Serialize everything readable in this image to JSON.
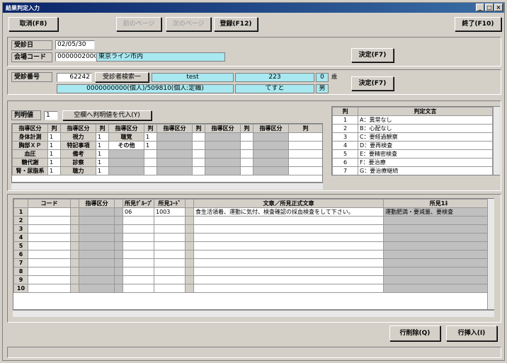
{
  "window": {
    "title": "結果判定入力"
  },
  "toolbar": {
    "cancel": "取消(F8)",
    "disabled1": "前のページ",
    "disabled2": "次のページ",
    "register": "登録(F12)",
    "exit": "終了(F10)"
  },
  "header": {
    "date_label": "受診日",
    "date_value": "02/05/30",
    "org_label": "会場コード",
    "org_code": "0000002000",
    "org_name": "東京ライン市内",
    "decide1": "決定(F7)",
    "exam_label": "受診番号",
    "exam_no": "62242",
    "exam_btn": "受診者検索一",
    "c1": "test",
    "c2": "223",
    "c3": "0",
    "c3_suffix": "歳",
    "c4": "0000000000(個人)/509810(個人:定職)",
    "c5": "てすと",
    "c6": "男",
    "decide2": "決定(F7)"
  },
  "judge": {
    "label": "判明値",
    "value": "1",
    "apply_btn": "空欄へ判明値を代入(Y)",
    "headers": [
      "指導区分",
      "判",
      "指導区分",
      "判",
      "指導区分",
      "判",
      "指導区分",
      "判",
      "指導区分",
      "判",
      "指導区分",
      "判"
    ],
    "rows": [
      [
        "身体計測",
        "1",
        "視力",
        "1",
        "聴覚",
        "1"
      ],
      [
        "胸部ＸＰ",
        "1",
        "特記事項",
        "1",
        "その他",
        "1"
      ],
      [
        "血圧",
        "1",
        "備考",
        "1",
        "",
        ""
      ],
      [
        "糖代謝",
        "1",
        "診察",
        "1",
        "",
        ""
      ],
      [
        "腎・尿脂系",
        "1",
        "聴力",
        "1",
        "",
        ""
      ]
    ]
  },
  "criteria": {
    "headers": [
      "判",
      "判定文言"
    ],
    "rows": [
      [
        "1",
        "A：異常なし"
      ],
      [
        "2",
        "B：心配なし"
      ],
      [
        "3",
        "C：要経過観察"
      ],
      [
        "4",
        "D：要再検査"
      ],
      [
        "5",
        "E：要精密検査"
      ],
      [
        "6",
        "F：要治療"
      ],
      [
        "7",
        "G：要治療継続"
      ]
    ]
  },
  "main": {
    "headers": [
      "コード",
      "指導区分",
      "所見ｸﾞﾙｰﾌﾟ",
      "所見ｺｰﾄﾞ",
      "文章／所見正式文章",
      "所見1ﾈ"
    ],
    "rows": [
      [
        "1",
        "",
        "",
        "06",
        "1003",
        "食生活領着、運動に気付、検査確認の採血検査をして下さい。",
        "運動肥満・要減量、要検査"
      ],
      [
        "2",
        "",
        "",
        "",
        "",
        "",
        ""
      ],
      [
        "3",
        "",
        "",
        "",
        "",
        "",
        ""
      ],
      [
        "4",
        "",
        "",
        "",
        "",
        "",
        ""
      ],
      [
        "5",
        "",
        "",
        "",
        "",
        "",
        ""
      ],
      [
        "6",
        "",
        "",
        "",
        "",
        "",
        ""
      ],
      [
        "7",
        "",
        "",
        "",
        "",
        "",
        ""
      ],
      [
        "8",
        "",
        "",
        "",
        "",
        "",
        ""
      ],
      [
        "9",
        "",
        "",
        "",
        "",
        "",
        ""
      ],
      [
        "10",
        "",
        "",
        "",
        "",
        "",
        ""
      ]
    ]
  },
  "footer": {
    "row_delete": "行削除(Q)",
    "row_insert": "行挿入(I)"
  }
}
